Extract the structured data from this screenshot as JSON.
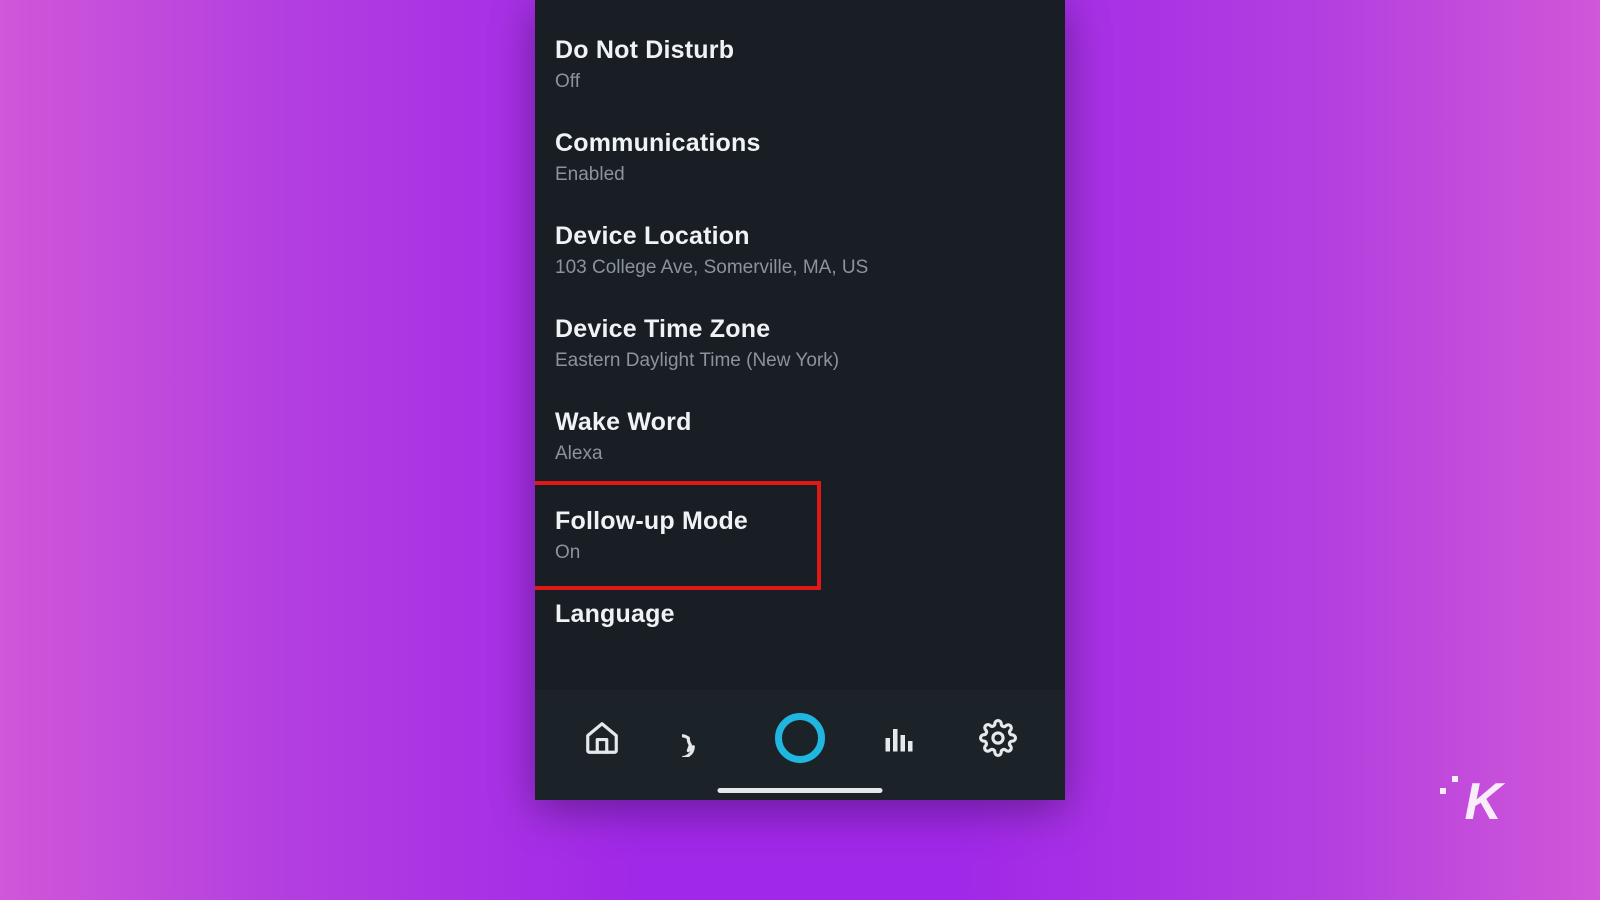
{
  "settings": [
    {
      "id": "dnd",
      "title": "Do Not Disturb",
      "value": "Off"
    },
    {
      "id": "comm",
      "title": "Communications",
      "value": "Enabled"
    },
    {
      "id": "location",
      "title": "Device Location",
      "value": "103 College Ave, Somerville, MA, US"
    },
    {
      "id": "timezone",
      "title": "Device Time Zone",
      "value": "Eastern Daylight Time (New York)"
    },
    {
      "id": "wakeword",
      "title": "Wake Word",
      "value": "Alexa"
    },
    {
      "id": "followup",
      "title": "Follow-up Mode",
      "value": "On",
      "highlighted": true
    },
    {
      "id": "language",
      "title": "Language",
      "value": ""
    }
  ],
  "colors": {
    "highlight_border": "#e01818",
    "alexa_accent": "#1fb6e0",
    "panel_bg": "#181e23"
  },
  "watermark": "K"
}
